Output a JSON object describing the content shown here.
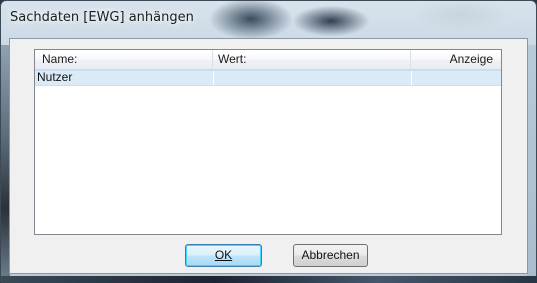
{
  "window": {
    "title": "Sachdaten [EWG] anhängen"
  },
  "listview": {
    "columns": [
      "Name:",
      "Wert:",
      "Anzeige"
    ],
    "rows": [
      {
        "name": "Nutzer",
        "wert": "",
        "anzeige": ""
      }
    ]
  },
  "buttons": {
    "ok_label": "OK",
    "cancel_label": "Abbrechen"
  },
  "colors": {
    "selection": "#dbeaf7",
    "default_button_border": "#3c7fb1"
  }
}
